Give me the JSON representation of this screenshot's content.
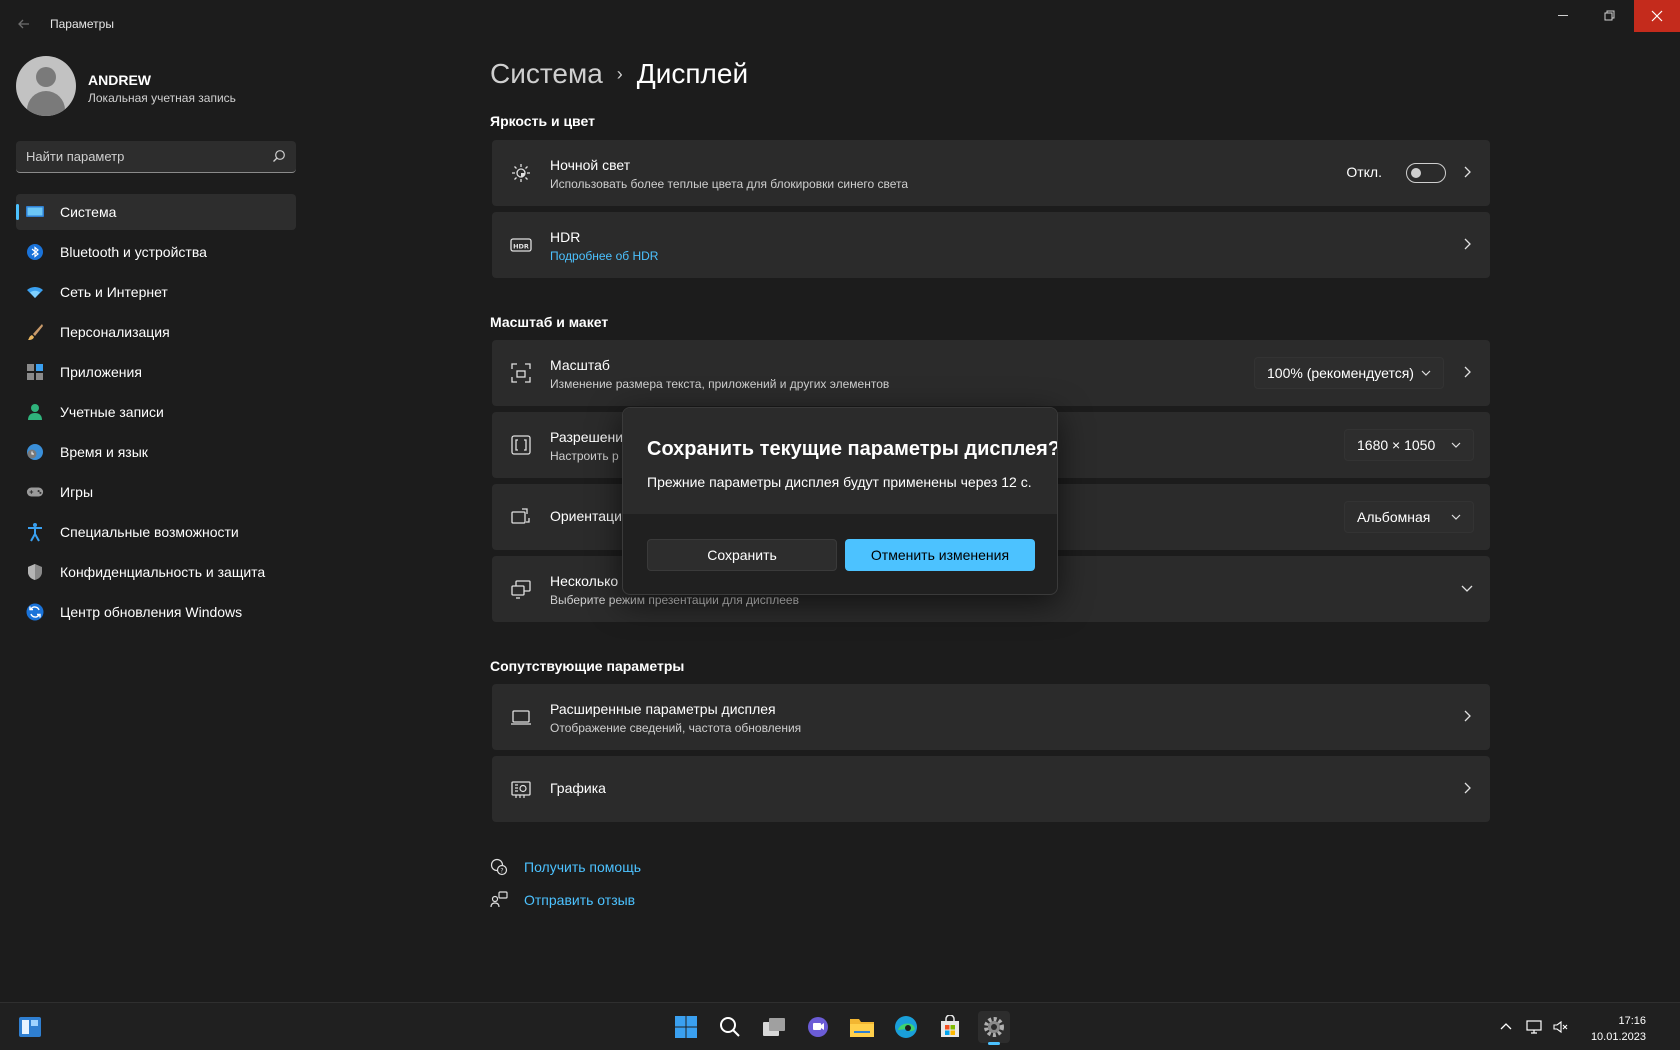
{
  "window": {
    "title": "Параметры",
    "controls": {
      "minimize": "—",
      "maximize": "▢",
      "close": "✕"
    }
  },
  "user": {
    "name": "ANDREW",
    "account_type": "Локальная учетная запись"
  },
  "search": {
    "placeholder": "Найти параметр"
  },
  "sidebar": {
    "items": [
      {
        "label": "Система",
        "icon": "system-icon",
        "active": true
      },
      {
        "label": "Bluetooth и устройства",
        "icon": "bluetooth-icon"
      },
      {
        "label": "Сеть и Интернет",
        "icon": "wifi-icon"
      },
      {
        "label": "Персонализация",
        "icon": "brush-icon"
      },
      {
        "label": "Приложения",
        "icon": "apps-icon"
      },
      {
        "label": "Учетные записи",
        "icon": "account-icon"
      },
      {
        "label": "Время и язык",
        "icon": "time-language-icon"
      },
      {
        "label": "Игры",
        "icon": "gamepad-icon"
      },
      {
        "label": "Специальные возможности",
        "icon": "accessibility-icon"
      },
      {
        "label": "Конфиденциальность и защита",
        "icon": "shield-icon"
      },
      {
        "label": "Центр обновления Windows",
        "icon": "update-icon"
      }
    ]
  },
  "breadcrumb": {
    "parent": "Система",
    "separator": "›",
    "current": "Дисплей"
  },
  "sections": {
    "brightness": "Яркость и цвет",
    "scale_layout": "Масштаб и макет",
    "related": "Сопутствующие параметры"
  },
  "cards": {
    "night_light": {
      "title": "Ночной свет",
      "subtitle": "Использовать более теплые цвета для блокировки синего света",
      "toggle_state": "Откл."
    },
    "hdr": {
      "title": "HDR",
      "link": "Подробнее об HDR"
    },
    "scale": {
      "title": "Масштаб",
      "subtitle": "Изменение размера текста, приложений и других элементов",
      "value": "100% (рекомендуется)"
    },
    "resolution": {
      "title": "Разрешени",
      "subtitle": "Настроить р",
      "value": "1680 × 1050"
    },
    "orientation": {
      "title": "Ориентаци",
      "value": "Альбомная"
    },
    "multiple": {
      "title": "Несколько",
      "subtitle": "Выберите режим презентации для дисплеев"
    },
    "advanced": {
      "title": "Расширенные параметры дисплея",
      "subtitle": "Отображение сведений, частота обновления"
    },
    "graphics": {
      "title": "Графика"
    }
  },
  "help": {
    "get_help": "Получить помощь",
    "feedback": "Отправить отзыв"
  },
  "dialog": {
    "title": "Сохранить текущие параметры дисплея?",
    "message": "Прежние параметры дисплея будут применены через 12 с.",
    "save_label": "Сохранить",
    "revert_label": "Отменить изменения"
  },
  "taskbar": {
    "time": "17:16",
    "date": "10.01.2023",
    "apps": [
      "start-icon",
      "search-icon",
      "task-view-icon",
      "chat-icon",
      "file-explorer-icon",
      "edge-icon",
      "store-icon",
      "settings-icon"
    ]
  },
  "colors": {
    "accent": "#4cc2ff",
    "background": "#1c1c1c",
    "card": "#2b2b2b",
    "close_button": "#c42b1c"
  }
}
